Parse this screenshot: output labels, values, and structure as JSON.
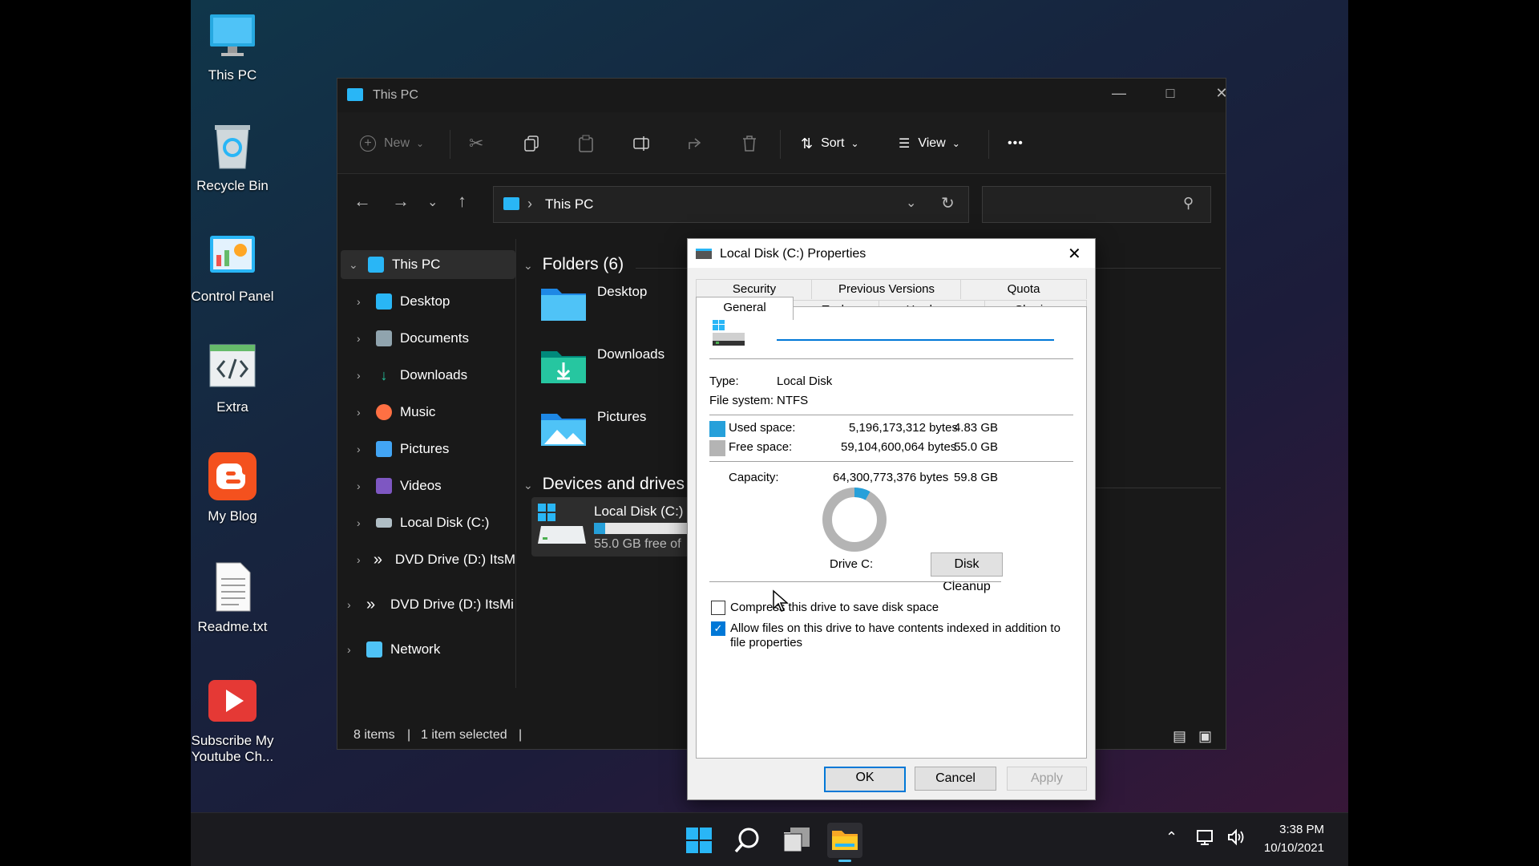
{
  "desktop": {
    "icons": [
      {
        "label": "This PC"
      },
      {
        "label": "Recycle Bin"
      },
      {
        "label": "Control Panel"
      },
      {
        "label": "Extra"
      },
      {
        "label": "My Blog"
      },
      {
        "label": "Readme.txt"
      },
      {
        "label": "Subscribe My Youtube Ch..."
      }
    ]
  },
  "explorer": {
    "title": "This PC",
    "toolbar": {
      "new_label": "New",
      "sort_label": "Sort",
      "view_label": "View",
      "more_label": "•••"
    },
    "address": {
      "path": "This PC",
      "separator": "›"
    },
    "nav": [
      {
        "label": "This PC"
      },
      {
        "label": "Desktop"
      },
      {
        "label": "Documents"
      },
      {
        "label": "Downloads"
      },
      {
        "label": "Music"
      },
      {
        "label": "Pictures"
      },
      {
        "label": "Videos"
      },
      {
        "label": "Local Disk (C:)"
      },
      {
        "label": "DVD Drive (D:) ItsM"
      },
      {
        "label": "DVD Drive (D:) ItsMi"
      },
      {
        "label": "Network"
      }
    ],
    "sections": {
      "folders": "Folders (6)",
      "devices": "Devices and drives"
    },
    "folders": [
      {
        "label": "Desktop"
      },
      {
        "label": "Downloads"
      },
      {
        "label": "Pictures"
      }
    ],
    "drive": {
      "label": "Local Disk (C:)",
      "free_text": "55.0 GB free of",
      "used_fraction": 0.081
    },
    "status": {
      "items": "8 items",
      "selected": "1 item selected"
    }
  },
  "dialog": {
    "title": "Local Disk (C:) Properties",
    "tabs_top": [
      "Security",
      "Previous Versions",
      "Quota"
    ],
    "tabs_bottom": [
      "General",
      "Tools",
      "Hardware",
      "Sharing"
    ],
    "name_value": "",
    "type_label": "Type:",
    "type_value": "Local Disk",
    "fs_label": "File system:",
    "fs_value": "NTFS",
    "used_label": "Used space:",
    "used_bytes": "5,196,173,312 bytes",
    "used_gb": "4.83 GB",
    "free_label": "Free space:",
    "free_bytes": "59,104,600,064 bytes",
    "free_gb": "55.0 GB",
    "capacity_label": "Capacity:",
    "capacity_bytes": "64,300,773,376 bytes",
    "capacity_gb": "59.8 GB",
    "drive_label": "Drive C:",
    "cleanup_label": "Disk Cleanup",
    "compress_label": "Compress this drive to save disk space",
    "index_label_1": "Allow files on this drive to have contents indexed in addition to",
    "index_label_2": "file properties",
    "ok_label": "OK",
    "cancel_label": "Cancel",
    "apply_label": "Apply",
    "used_color": "#26a0da",
    "free_color": "#b4b4b4"
  },
  "taskbar": {
    "time": "3:38 PM",
    "date": "10/10/2021"
  }
}
